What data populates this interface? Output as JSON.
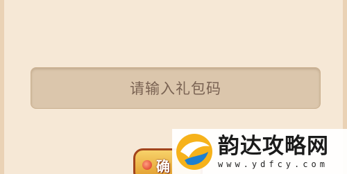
{
  "gift_code_input": {
    "placeholder": "请输入礼包码"
  },
  "confirm_button": {
    "label": "确"
  },
  "watermark": {
    "brand": "韵达攻略网",
    "url": "www.ydfcy.com"
  }
}
